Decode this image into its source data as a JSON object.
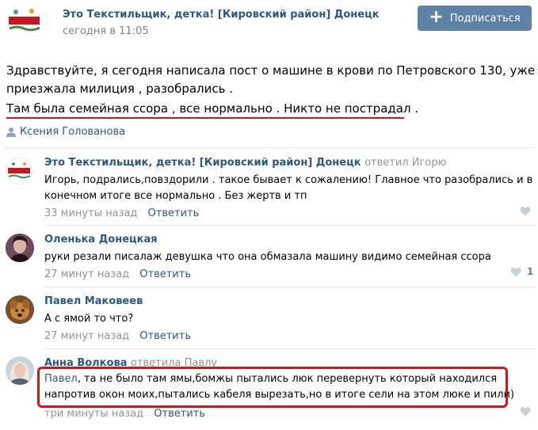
{
  "group": {
    "name": "Это Текстильщик, детка! [Кировский район] Донецк",
    "posted_at": "сегодня в 11:05",
    "avatar_banner": "ЭТО ТЕКСТИЛЬЩИК, ДЕТКА!"
  },
  "subscribe_label": "Подписаться",
  "post": {
    "lines": [
      "Здравствуйте, я сегодня написала пост о машине в крови по Петровского 130, уже",
      "приезжала милиция , разобрались .",
      "Там была семейная ссора , все нормально . Никто не пострадал ."
    ],
    "signature": "Ксения Голованова"
  },
  "comments": [
    {
      "author": "Это Текстильщик, детка! [Кировский район] Донецк",
      "reply_to": "ответил Игорю",
      "lines": [
        "Игорь, подрались,повздорили . такое бывает к сожалению! Главное что разобрались и в",
        "конечном итоге все нормально . Без жертв и тп"
      ],
      "time": "33 минуты назад",
      "answer_label": "Ответить",
      "likes": ""
    },
    {
      "author": "Оленька Донецкая",
      "reply_to": "",
      "lines": [
        "руки резали писалаж девушка что она обмазала машину видимо семейная ссора"
      ],
      "time": "27 минут назад",
      "answer_label": "Ответить",
      "likes": "1"
    },
    {
      "author": "Павел Маковеев",
      "reply_to": "",
      "lines": [
        "А с ямой то что?"
      ],
      "time": "27 минут назад",
      "answer_label": "Ответить",
      "likes": ""
    },
    {
      "author": "Анна Волкова",
      "reply_to": "ответила Павлу",
      "mention": "Павел",
      "lines": [
        ", та не было там ямы,бомжы пытались люк перевернуть который находился",
        "напротив окон моих,пытались кабеля вырезать,но в итоге сели на этом люке и пили)"
      ],
      "time": "три минуты назад",
      "answer_label": "Ответить",
      "likes": ""
    }
  ],
  "colors": {
    "link": "#2a5885",
    "button": "#5e81a8",
    "highlight": "#d1151a",
    "muted": "#939393"
  },
  "icons": {
    "author": "person-icon",
    "like": "heart-icon",
    "subscribe": "plus-icon"
  }
}
